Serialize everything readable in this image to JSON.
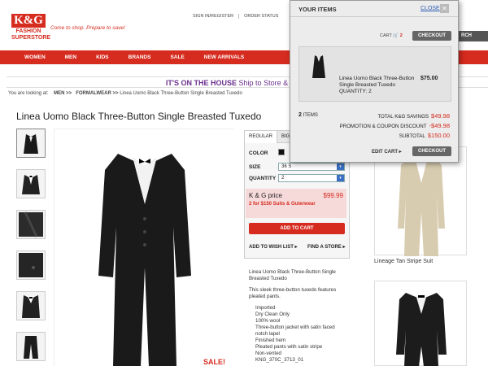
{
  "brand": {
    "logo_top": "K&G",
    "logo_sub": "FASHION\nSUPERSTORE",
    "tagline": "Come to shop. Prepare to save!",
    "accent": "#d62b1f",
    "promo_color": "#6a2f8c"
  },
  "toplinks": [
    "SIGN IN/REGISTER",
    "ORDER STATUS"
  ],
  "search_button": "RCH",
  "nav": [
    "WOMEN",
    "MEN",
    "KIDS",
    "BRANDS",
    "SALE",
    "NEW ARRIVALS"
  ],
  "promo": {
    "bold": "IT'S ON THE HOUSE",
    "rest": " Ship to Store & Return Ship"
  },
  "breadcrumb": {
    "prefix": "You are looking at:",
    "b1": "MEN >>",
    "b2": "FORMALWEAR >>",
    "current": "Linea Uomo Black Three-Button Single Breasted Tuxedo"
  },
  "product": {
    "title": "Linea Uomo Black Three-Button Single Breasted Tuxedo",
    "tabs": [
      "REGULAR",
      "BIG"
    ],
    "color_label": "COLOR",
    "size_label": "SIZE",
    "size_value": "36 S",
    "qty_label": "QUANTITY",
    "qty_value": "2",
    "price_label": "K & G price",
    "price_value": "$99.99",
    "offer": "2 for $150 Suits & Outerwear",
    "add_to_cart": "ADD TO CART",
    "wishlist": "ADD TO WISH LIST ▸",
    "find_store": "FIND A STORE ▸",
    "sale_badge": "SALE!",
    "desc_title": "Linea Uomo Black Three-Button Single Breasted Tuxedo",
    "desc_body": "This sleek three-button tuxedo features pleated pants.",
    "desc_list": [
      "Imported",
      "Dry Clean Only",
      "100% wool",
      "Three-button jacket with satin faced notch lapel",
      "Finished hem",
      "Pleated pants with satin stripe",
      "Non-vented",
      "KNG_370C_3713_01"
    ]
  },
  "related": {
    "label1": "Lineage Tan Stripe Suit"
  },
  "cart": {
    "title": "YOUR ITEMS",
    "close": "CLOSE",
    "cart_label": "CART",
    "cart_count": "2",
    "checkout": "CHECKOUT",
    "item_name_l1": "Linea Uomo Black Three-Button",
    "item_name_l2": "Single Breasted Tuxedo",
    "item_qty": "QUANTITY: 2",
    "item_price": "$75.00",
    "items_count": "2",
    "items_label": "ITEMS",
    "savings_label": "TOTAL K&G SAVINGS",
    "savings_value": "$49.98",
    "discount_label": "PROMOTION & COUPON DISCOUNT",
    "discount_value": "-$49.98",
    "subtotal_label": "SUBTOTAL",
    "subtotal_value": "$150.00",
    "edit_cart": "EDIT CART ▸"
  }
}
